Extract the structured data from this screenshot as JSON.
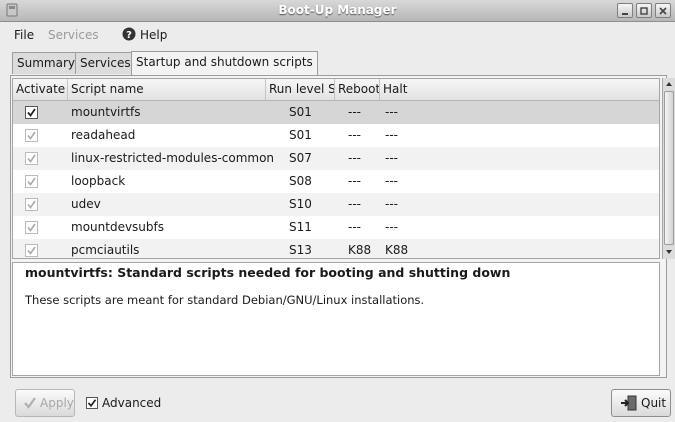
{
  "window": {
    "title": "Boot-Up Manager"
  },
  "menubar": {
    "file": "File",
    "services": "Services",
    "help": "Help"
  },
  "tabs": [
    {
      "label": "Summary",
      "active": false
    },
    {
      "label": "Services",
      "active": false
    },
    {
      "label": "Startup and shutdown scripts",
      "active": true
    }
  ],
  "table": {
    "columns": [
      "Activate",
      "Script name",
      "Run level S",
      "Reboot",
      "Halt"
    ],
    "rows": [
      {
        "activate": true,
        "name": "mountvirtfs",
        "runlevel": "S01",
        "reboot": "---",
        "halt": "---",
        "selected": true
      },
      {
        "activate": true,
        "name": "readahead",
        "runlevel": "S01",
        "reboot": "---",
        "halt": "---",
        "selected": false
      },
      {
        "activate": true,
        "name": "linux-restricted-modules-common",
        "runlevel": "S07",
        "reboot": "---",
        "halt": "---",
        "selected": false
      },
      {
        "activate": true,
        "name": "loopback",
        "runlevel": "S08",
        "reboot": "---",
        "halt": "---",
        "selected": false
      },
      {
        "activate": true,
        "name": "udev",
        "runlevel": "S10",
        "reboot": "---",
        "halt": "---",
        "selected": false
      },
      {
        "activate": true,
        "name": "mountdevsubfs",
        "runlevel": "S11",
        "reboot": "---",
        "halt": "---",
        "selected": false
      },
      {
        "activate": true,
        "name": "pcmciautils",
        "runlevel": "S13",
        "reboot": "K88",
        "halt": "K88",
        "selected": false
      }
    ]
  },
  "description": {
    "title": "mountvirtfs: Standard scripts needed for booting and shutting down",
    "body": "These scripts are meant for standard Debian/GNU/Linux installations."
  },
  "footer": {
    "apply_label": "Apply",
    "advanced_label": "Advanced",
    "advanced_checked": true,
    "quit_label": "Quit"
  },
  "icons": [
    "app-icon",
    "minimize-icon",
    "maximize-icon",
    "close-icon",
    "help-icon",
    "checkbox-icon",
    "apply-check-icon",
    "quit-door-icon"
  ],
  "colors": {
    "selection": "#d6d6d6",
    "title_text": "#ffffff"
  }
}
